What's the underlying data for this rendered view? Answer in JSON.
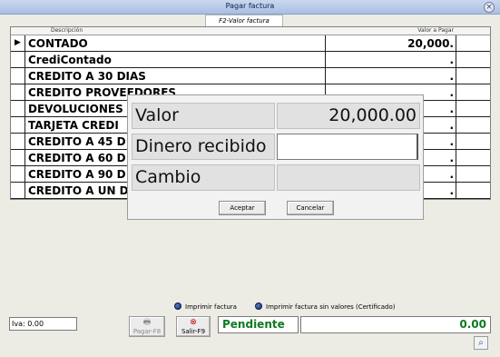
{
  "window": {
    "title": "Pagar factura",
    "tab": "F2-Valor factura"
  },
  "grid": {
    "headers": {
      "description": "Descripción",
      "value": "Valor a Pagar"
    },
    "rows": [
      {
        "indicator": "▶",
        "desc": "CONTADO",
        "value": "20,000."
      },
      {
        "indicator": "",
        "desc": "CrediContado",
        "value": "."
      },
      {
        "indicator": "",
        "desc": "CREDITO A 30 DIAS",
        "value": "."
      },
      {
        "indicator": "",
        "desc": "CREDITO PROVEEDORES",
        "value": "."
      },
      {
        "indicator": "",
        "desc": "DEVOLUCIONES",
        "value": "."
      },
      {
        "indicator": "",
        "desc": "TARJETA CREDI",
        "value": "."
      },
      {
        "indicator": "",
        "desc": "CREDITO A 45 D",
        "value": "."
      },
      {
        "indicator": "",
        "desc": "CREDITO A 60 D",
        "value": "."
      },
      {
        "indicator": "",
        "desc": "CREDITO A 90 D",
        "value": "."
      },
      {
        "indicator": "",
        "desc": "CREDITO A UN D",
        "value": "."
      }
    ]
  },
  "dialog": {
    "valor_label": "Valor",
    "valor_value": "20,000.00",
    "dinero_label": "Dinero recibido",
    "dinero_value": "",
    "cambio_label": "Cambio",
    "cambio_value": "",
    "accept": "Aceptar",
    "cancel": "Cancelar"
  },
  "options": {
    "print_invoice": "Imprimir factura",
    "print_no_values": "Imprimir factura sin valores (Certificado)"
  },
  "footer": {
    "iva": "Iva: 0.00",
    "pay_button": "Pagar-F8",
    "exit_button": "Salir-F9",
    "status": "Pendiente",
    "total": "0.00"
  },
  "colors": {
    "status_green": "#0d7a1f",
    "title_bar": "#a9bfe2"
  },
  "icons": [
    "close-icon",
    "row-pointer-icon",
    "pay-icon",
    "exit-icon",
    "magnifier-icon"
  ]
}
